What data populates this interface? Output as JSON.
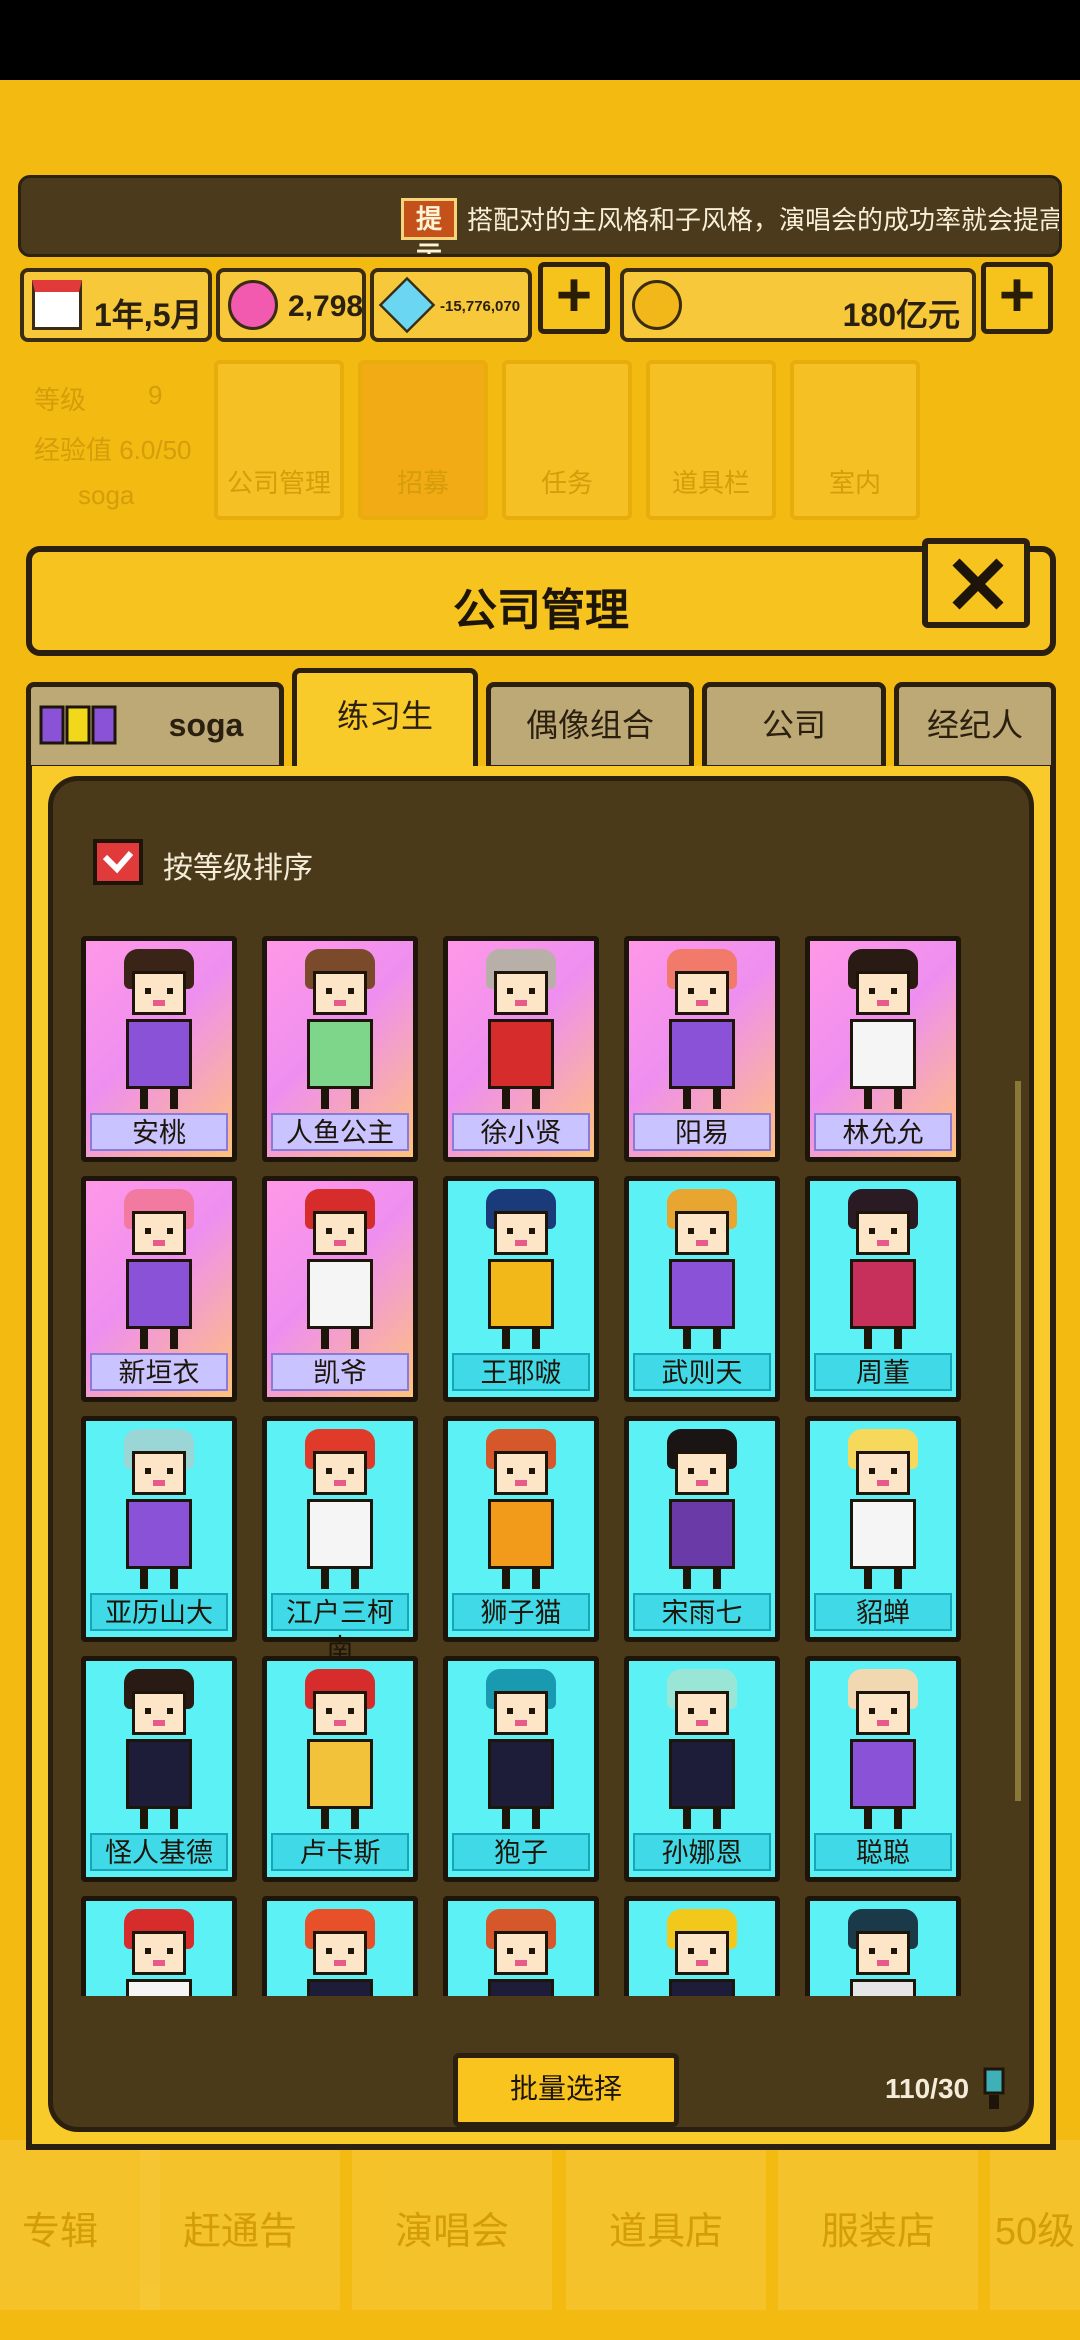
{
  "tip": {
    "icon_label": "提示",
    "text": "搭配对的主风格和子风格，演唱会的成功率就会提高。"
  },
  "resources": {
    "date": "1年,5月",
    "gems": "2,798",
    "crystals": "-15,776,070",
    "money": "180亿元"
  },
  "menu": {
    "level_label": "等级",
    "level_value": "9",
    "exp_label": "经验值 6.0/50",
    "player_name": "soga",
    "items": [
      {
        "label": "公司管理"
      },
      {
        "label": "招募"
      },
      {
        "label": "任务"
      },
      {
        "label": "道具栏"
      },
      {
        "label": "室内"
      }
    ]
  },
  "bottom_nav": [
    "专辑",
    "赶通告",
    "演唱会",
    "道具店",
    "服装店",
    "50级"
  ],
  "modal": {
    "title": "公司管理",
    "tabs": [
      "soga",
      "练习生",
      "偶像组合",
      "公司",
      "经纪人"
    ],
    "active_tab": "练习生",
    "sort_label": "按等级排序",
    "batch_button": "批量选择",
    "count": "110/30"
  },
  "trainees": [
    {
      "name": "安桃",
      "rarity": "pink",
      "hair": "#3a2418",
      "outfit": "#8a52d6"
    },
    {
      "name": "人鱼公主",
      "rarity": "pink",
      "hair": "#7a4a2a",
      "outfit": "#7ed68a"
    },
    {
      "name": "徐小贤",
      "rarity": "pink",
      "hair": "#b8b0a8",
      "outfit": "#d62c2c"
    },
    {
      "name": "阳易",
      "rarity": "pink",
      "hair": "#f27a6a",
      "outfit": "#8a52d6"
    },
    {
      "name": "林允允",
      "rarity": "pink",
      "hair": "#2a1a14",
      "outfit": "#f5f5f5"
    },
    {
      "name": "新垣衣",
      "rarity": "pink",
      "hair": "#f27aa0",
      "outfit": "#8a52d6"
    },
    {
      "name": "凯爷",
      "rarity": "pink",
      "hair": "#d62c2c",
      "outfit": "#f5f5f5"
    },
    {
      "name": "王耶啵",
      "rarity": "cyan",
      "hair": "#1a3a7a",
      "outfit": "#f2b81a"
    },
    {
      "name": "武则天",
      "rarity": "cyan",
      "hair": "#e8a630",
      "outfit": "#8a52d6"
    },
    {
      "name": "周董",
      "rarity": "cyan",
      "hair": "#2a1a24",
      "outfit": "#c6305a"
    },
    {
      "name": "亚历山大",
      "rarity": "cyan",
      "hair": "#9ad6d6",
      "outfit": "#8a52d6"
    },
    {
      "name": "江户三柯南",
      "rarity": "cyan",
      "hair": "#e03a2a",
      "outfit": "#f5f5f5"
    },
    {
      "name": "狮子猫",
      "rarity": "cyan",
      "hair": "#d6582a",
      "outfit": "#f29a1a"
    },
    {
      "name": "宋雨七",
      "rarity": "cyan",
      "hair": "#1a1414",
      "outfit": "#6a3aa6"
    },
    {
      "name": "貂蝉",
      "rarity": "cyan",
      "hair": "#f6d85a",
      "outfit": "#f5f5f5"
    },
    {
      "name": "怪人基德",
      "rarity": "cyan",
      "hair": "#2a1a14",
      "outfit": "#1d1d3a"
    },
    {
      "name": "卢卡斯",
      "rarity": "cyan",
      "hair": "#d62c2c",
      "outfit": "#f2c23a"
    },
    {
      "name": "狍子",
      "rarity": "cyan",
      "hair": "#1a9ab0",
      "outfit": "#1d1d3a"
    },
    {
      "name": "孙娜恩",
      "rarity": "cyan",
      "hair": "#9ae6d6",
      "outfit": "#1d1d3a"
    },
    {
      "name": "聪聪",
      "rarity": "cyan",
      "hair": "#f2d8b0",
      "outfit": "#8a52d6"
    },
    {
      "name": "",
      "rarity": "cyan",
      "hair": "#d62c2c",
      "outfit": "#f5f5f5"
    },
    {
      "name": "",
      "rarity": "cyan",
      "hair": "#e8502a",
      "outfit": "#1d1d3a"
    },
    {
      "name": "",
      "rarity": "cyan",
      "hair": "#d6582a",
      "outfit": "#1d1d3a"
    },
    {
      "name": "",
      "rarity": "cyan",
      "hair": "#f2c81a",
      "outfit": "#1d1d3a"
    },
    {
      "name": "",
      "rarity": "cyan",
      "hair": "#1a3a4a",
      "outfit": "#e6e6e6"
    }
  ]
}
